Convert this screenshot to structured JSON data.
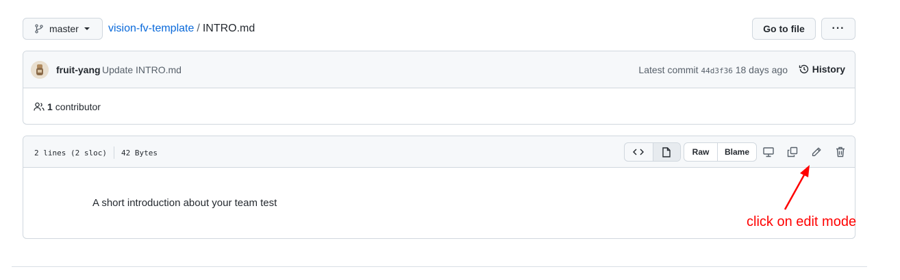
{
  "header": {
    "branch": "master",
    "repo": "vision-fv-template",
    "separator": "/",
    "file": "INTRO.md",
    "goto_file": "Go to file",
    "more": "···"
  },
  "commit": {
    "author": "fruit-yang",
    "message": "Update INTRO.md",
    "latest_label": "Latest commit",
    "sha": "44d3f36",
    "age": "18 days ago",
    "history": "History",
    "contributors_count": "1",
    "contributors_label": "contributor"
  },
  "file": {
    "lines": "2 lines (2 sloc)",
    "size": "42 Bytes",
    "raw": "Raw",
    "blame": "Blame",
    "content": "A short introduction about your team test"
  },
  "annotation": {
    "text": "click on edit mode",
    "color": "#ff0000"
  },
  "colors": {
    "link": "#0969da",
    "border": "#d0d7de",
    "header_bg": "#f6f8fa"
  }
}
